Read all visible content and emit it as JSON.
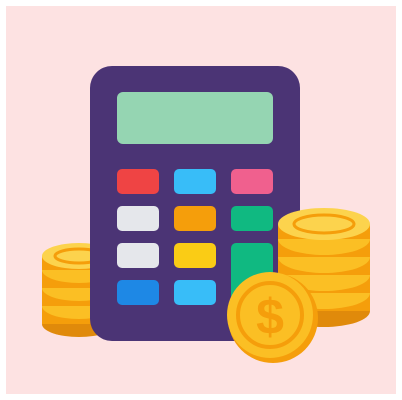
{
  "illustration": {
    "subject": "calculator-with-coin-stacks-icon",
    "colors": {
      "background": "#fde2e2",
      "calculator_body": "#4b3475",
      "screen": "#95d5b2",
      "red_key": "#ef4444",
      "blue_key": "#38bdf8",
      "pink_key": "#f0608e",
      "gray_key": "#e5e7eb",
      "orange_key": "#f59e0b",
      "green_key": "#10b981",
      "yellow_key": "#facc15",
      "dark_blue_key": "#1e88e5",
      "coin_gold": "#fbbf24",
      "coin_shadow": "#f59e0b",
      "coin_dark": "#e08a0b"
    },
    "coin_symbol": "$"
  }
}
